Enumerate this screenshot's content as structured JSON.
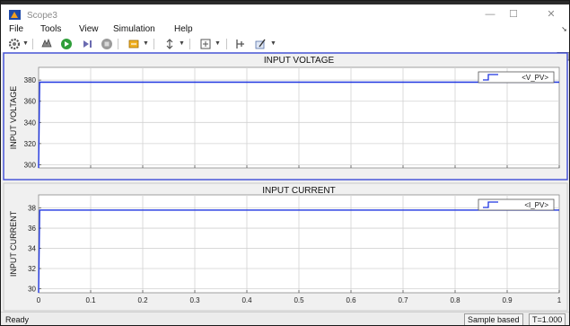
{
  "window": {
    "title": "Scope3",
    "minimize": "—",
    "maximize": "☐",
    "close": "✕"
  },
  "menu": [
    "File",
    "Tools",
    "View",
    "Simulation",
    "Help"
  ],
  "toolbar_icons": [
    "settings-icon",
    "highlight-icon",
    "run-icon",
    "step-forward-icon",
    "stop-icon",
    "signal-selector-icon",
    "zoom-icon",
    "fit-axes-icon",
    "cursor-measure-icon",
    "style-icon"
  ],
  "plots": [
    {
      "title": "INPUT VOLTAGE",
      "ylabel": "INPUT VOLTAGE",
      "legend": "<V_PV>",
      "yticks": [
        "380",
        "360",
        "340",
        "320",
        "300"
      ]
    },
    {
      "title": "INPUT CURRENT",
      "ylabel": "INPUT CURRENT",
      "legend": "<I_PV>",
      "yticks": [
        "38",
        "36",
        "34",
        "32",
        "30"
      ]
    }
  ],
  "xticks": [
    "0",
    "0.1",
    "0.2",
    "0.3",
    "0.4",
    "0.5",
    "0.6",
    "0.7",
    "0.8",
    "0.9",
    "1"
  ],
  "status": {
    "left": "Ready",
    "mode": "Sample based",
    "time": "T=1.000"
  },
  "colors": {
    "signal": "#1f35e0",
    "frame": "#1a1a1a",
    "selected_border": "#3d4ad6"
  },
  "chart_data": [
    {
      "type": "line",
      "title": "INPUT VOLTAGE",
      "xlabel": "",
      "ylabel": "INPUT VOLTAGE",
      "xlim": [
        0,
        1
      ],
      "ylim": [
        297,
        392
      ],
      "grid": true,
      "legend_position": "top-right",
      "series": [
        {
          "name": "<V_PV>",
          "x": [
            0,
            0.002,
            1
          ],
          "y": [
            297,
            378,
            378
          ]
        }
      ]
    },
    {
      "type": "line",
      "title": "INPUT CURRENT",
      "xlabel": "",
      "ylabel": "INPUT CURRENT",
      "xlim": [
        0,
        1
      ],
      "ylim": [
        29.6,
        39.3
      ],
      "grid": true,
      "legend_position": "top-right",
      "series": [
        {
          "name": "<I_PV>",
          "x": [
            0,
            0.002,
            1
          ],
          "y": [
            29.6,
            37.8,
            37.8
          ]
        }
      ]
    }
  ]
}
